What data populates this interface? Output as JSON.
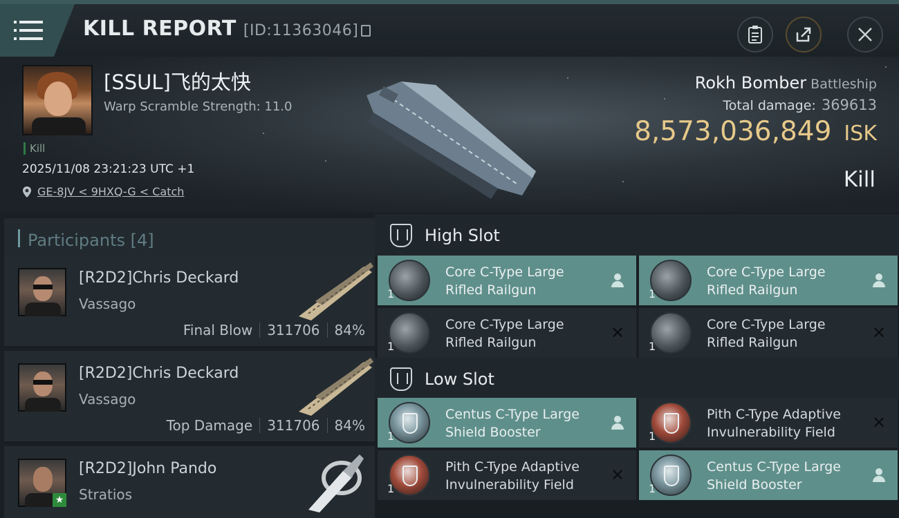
{
  "header": {
    "title": "KILL REPORT",
    "report_id": "[ID:11363046]",
    "icons": [
      "menu-icon",
      "copy-icon",
      "clipboard-icon",
      "share-icon",
      "close-icon"
    ]
  },
  "victim": {
    "name": "[SSUL]飞的太快",
    "warp_scramble": "Warp Scramble Strength: 11.0",
    "kill_tag": "Kill",
    "timestamp": "2025/11/08 23:21:23 UTC +1",
    "location": "GE-8JV < 9HXQ-G < Catch",
    "ship_name": "Rokh Bomber",
    "ship_class": "Battleship",
    "total_damage_label": "Total damage:",
    "total_damage": "369613",
    "isk_value": "8,573,036,849",
    "isk_unit": "ISK",
    "result": "Kill"
  },
  "participants": {
    "label": "Participants",
    "count": "[4]",
    "items": [
      {
        "name": "[R2D2]Chris Deckard",
        "ship": "Vassago",
        "role": "Final Blow",
        "damage": "311706",
        "percent": "84%"
      },
      {
        "name": "[R2D2]Chris Deckard",
        "ship": "Vassago",
        "role": "Top Damage",
        "damage": "311706",
        "percent": "84%"
      },
      {
        "name": "[R2D2]John Pando",
        "ship": "Stratios",
        "role": "",
        "damage": "",
        "percent": ""
      }
    ]
  },
  "fitting": {
    "high_slot_label": "High Slot",
    "low_slot_label": "Low Slot",
    "high_slots": [
      {
        "name_line1": "Core C-Type Large",
        "name_line2": "Rifled Railgun",
        "qty": "1",
        "status": "dropped"
      },
      {
        "name_line1": "Core C-Type Large",
        "name_line2": "Rifled Railgun",
        "qty": "1",
        "status": "dropped"
      },
      {
        "name_line1": "Core C-Type Large",
        "name_line2": "Rifled Railgun",
        "qty": "1",
        "status": "destroyed"
      },
      {
        "name_line1": "Core C-Type Large",
        "name_line2": "Rifled Railgun",
        "qty": "1",
        "status": "destroyed"
      }
    ],
    "low_slots": [
      {
        "name_line1": "Centus C-Type Large",
        "name_line2": "Shield Booster",
        "qty": "1",
        "status": "dropped"
      },
      {
        "name_line1": "Pith C-Type Adaptive",
        "name_line2": "Invulnerability Field",
        "qty": "1",
        "status": "destroyed"
      },
      {
        "name_line1": "Pith C-Type Adaptive",
        "name_line2": "Invulnerability Field",
        "qty": "1",
        "status": "destroyed"
      },
      {
        "name_line1": "Centus C-Type Large",
        "name_line2": "Shield Booster",
        "qty": "1",
        "status": "dropped"
      }
    ]
  },
  "colors": {
    "accent": "#5f8f8b",
    "isk": "#e7c98a",
    "kill_tag": "#2f7a48"
  }
}
